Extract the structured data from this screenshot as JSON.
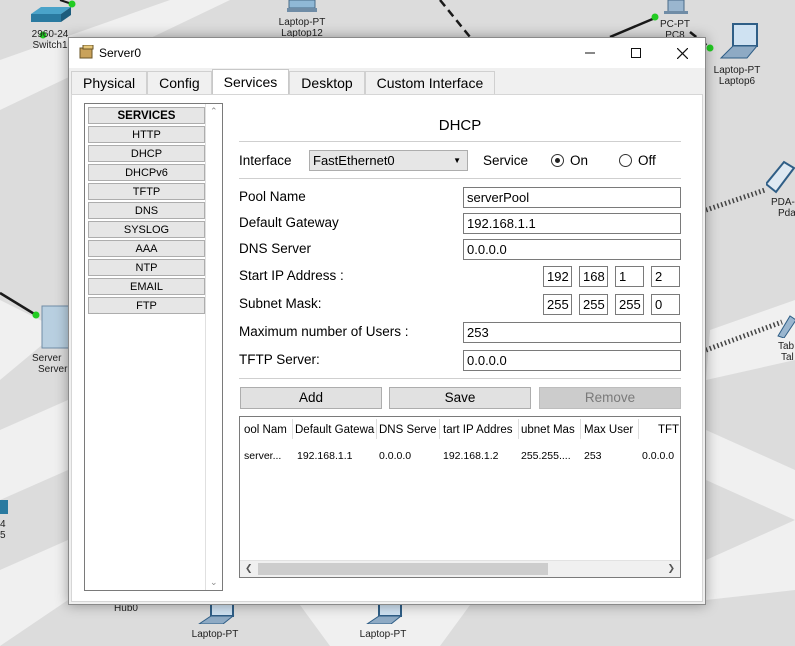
{
  "workspace": {
    "devices": [
      {
        "id": "switch1",
        "model": "2960-24",
        "name": "Switch1"
      },
      {
        "id": "laptop12",
        "model": "Laptop-PT",
        "name": "Laptop12"
      },
      {
        "id": "pc8",
        "model": "PC-PT",
        "name": "PC8"
      },
      {
        "id": "laptop6",
        "model": "Laptop-PT",
        "name": "Laptop6"
      },
      {
        "id": "pda",
        "model": "PDA-",
        "name": "Pda"
      },
      {
        "id": "server",
        "model": "Server",
        "name": "Server"
      },
      {
        "id": "tablet",
        "model": "Tab",
        "name": "Tal"
      },
      {
        "id": "hub0",
        "model": "",
        "name": "Hub0"
      },
      {
        "id": "laptop-bl",
        "model": "Laptop-PT",
        "name": ""
      },
      {
        "id": "laptop-bm",
        "model": "Laptop-PT",
        "name": ""
      },
      {
        "id": "left-partial",
        "model": "4",
        "name": "5"
      }
    ],
    "link_color": "#1a1a1a",
    "port_color": "#22cc22"
  },
  "window": {
    "title": "Server0",
    "tabs": [
      "Physical",
      "Config",
      "Services",
      "Desktop",
      "Custom Interface"
    ],
    "active_tab": "Services"
  },
  "services": {
    "header": "SERVICES",
    "items": [
      "HTTP",
      "DHCP",
      "DHCPv6",
      "TFTP",
      "DNS",
      "SYSLOG",
      "AAA",
      "NTP",
      "EMAIL",
      "FTP"
    ]
  },
  "dhcp": {
    "title": "DHCP",
    "interface_label": "Interface",
    "interface_value": "FastEthernet0",
    "service_label": "Service",
    "on_label": "On",
    "off_label": "Off",
    "service_state": "On",
    "pool_name_label": "Pool Name",
    "pool_name": "serverPool",
    "gateway_label": "Default Gateway",
    "gateway": "192.168.1.1",
    "dns_label": "DNS Server",
    "dns": "0.0.0.0",
    "start_ip_label": "Start IP Address :",
    "start_ip": [
      "192",
      "168",
      "1",
      "2"
    ],
    "subnet_label": "Subnet Mask:",
    "subnet": [
      "255",
      "255",
      "255",
      "0"
    ],
    "max_users_label": "Maximum number of Users :",
    "max_users": "253",
    "tftp_label": "TFTP Server:",
    "tftp": "0.0.0.0",
    "buttons": {
      "add": "Add",
      "save": "Save",
      "remove": "Remove"
    },
    "table": {
      "headers": [
        "ool Nam",
        "Default Gatewa",
        "DNS Server",
        "tart IP Addres",
        "ubnet Mas",
        "Max User",
        "TFTP"
      ],
      "rows": [
        [
          "server...",
          "192.168.1.1",
          "0.0.0.0",
          "192.168.1.2",
          "255.255....",
          "253",
          "0.0.0.0"
        ]
      ]
    }
  }
}
